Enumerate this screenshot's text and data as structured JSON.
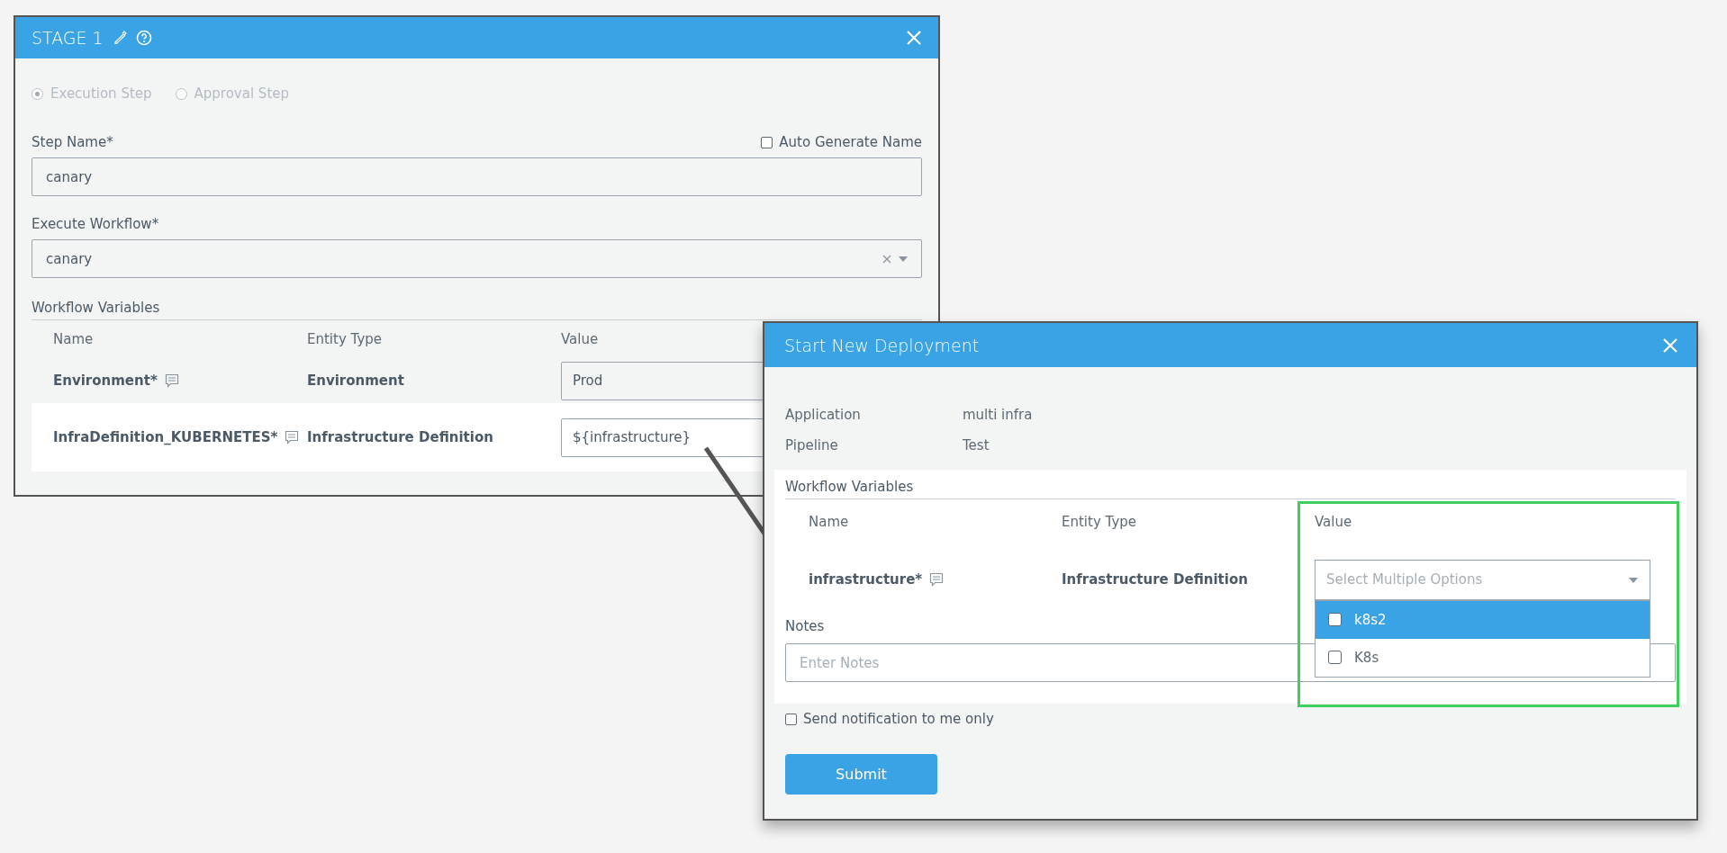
{
  "stage_dialog": {
    "title": "STAGE 1",
    "step_types": {
      "disabled": true,
      "options": [
        {
          "label": "Execution Step",
          "selected": true
        },
        {
          "label": "Approval Step",
          "selected": false
        }
      ]
    },
    "step_name": {
      "label": "Step Name*",
      "value": "canary"
    },
    "auto_generate": {
      "label": "Auto Generate Name",
      "checked": false
    },
    "execute_workflow": {
      "label": "Execute Workflow*",
      "value": "canary"
    },
    "workflow_variables": {
      "title": "Workflow Variables",
      "columns": [
        "Name",
        "Entity Type",
        "Value"
      ],
      "rows": [
        {
          "name": "Environment*",
          "entity_type": "Environment",
          "value": "Prod",
          "highlighted": false
        },
        {
          "name": "InfraDefinition_KUBERNETES*",
          "entity_type": "Infrastructure Definition",
          "value": "${infrastructure}",
          "highlighted": true
        }
      ]
    }
  },
  "deploy_dialog": {
    "title": "Start New Deployment",
    "info": [
      {
        "label": "Application",
        "value": "multi infra"
      },
      {
        "label": "Pipeline",
        "value": "Test"
      }
    ],
    "workflow_variables": {
      "title": "Workflow Variables",
      "columns": [
        "Name",
        "Entity Type",
        "Value"
      ],
      "rows": [
        {
          "name": "infrastructure*",
          "entity_type": "Infrastructure Definition",
          "placeholder": "Select Multiple Options",
          "options": [
            {
              "label": "k8s2",
              "checked": false,
              "selected": true
            },
            {
              "label": "K8s",
              "checked": false,
              "selected": false
            }
          ]
        }
      ]
    },
    "notes": {
      "label": "Notes",
      "placeholder": "Enter Notes"
    },
    "notify": {
      "label": "Send notification to me only",
      "checked": false
    },
    "submit": "Submit"
  }
}
